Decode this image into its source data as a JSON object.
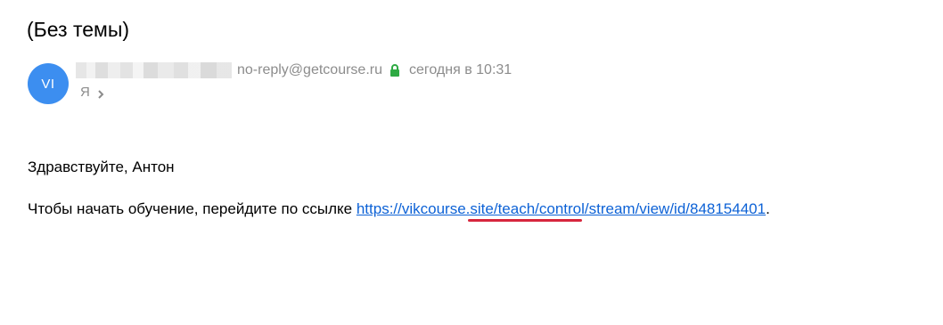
{
  "email": {
    "subject": "(Без темы)",
    "sender": {
      "avatar_initials": "VI",
      "email": "no-reply@getcourse.ru",
      "date": "сегодня в 10:31"
    },
    "recipient": "Я",
    "body": {
      "greeting": "Здравствуйте, Антон",
      "line_prefix": "Чтобы начать обучение, перейдите по ссылке ",
      "link_text": "https://vikcourse.site/teach/control/stream/view/id/848154401",
      "line_suffix": "."
    }
  },
  "colors": {
    "avatar_bg": "#3c8ef0",
    "link": "#0d62d6",
    "lock": "#2eaa43",
    "annotation_underline": "#d7263d",
    "muted_text": "#8c8c8c"
  },
  "icons": {
    "lock": "lock-icon",
    "recipient_chevron": "chevron-right-icon"
  }
}
